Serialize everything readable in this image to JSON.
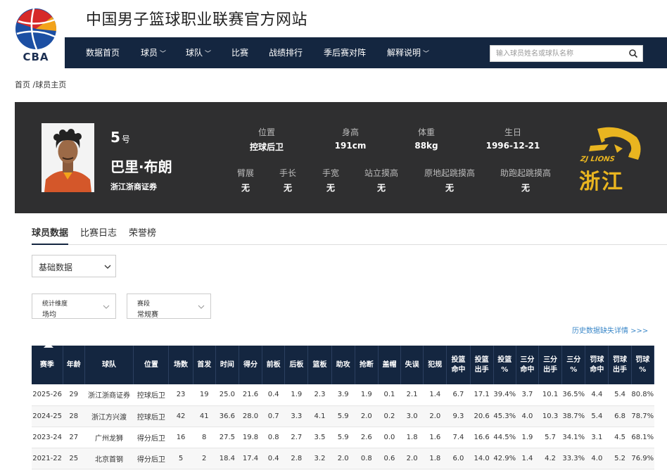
{
  "site_title": "中国男子篮球职业联赛官方网站",
  "logo_text": "CBA",
  "nav": [
    {
      "label": "数据首页",
      "dropdown": false
    },
    {
      "label": "球员",
      "dropdown": true
    },
    {
      "label": "球队",
      "dropdown": true
    },
    {
      "label": "比赛",
      "dropdown": false
    },
    {
      "label": "战绩排行",
      "dropdown": false
    },
    {
      "label": "季后赛对阵",
      "dropdown": false
    },
    {
      "label": "解释说明",
      "dropdown": true
    }
  ],
  "search": {
    "placeholder": "输入球员姓名或球队名称"
  },
  "breadcrumb": "首页 /球员主页",
  "player": {
    "number": "5",
    "number_suffix": "号",
    "name": "巴里·布朗",
    "team": "浙江浙商证券",
    "attrs_row1": [
      {
        "label": "位置",
        "value": "控球后卫"
      },
      {
        "label": "身高",
        "value": "191cm"
      },
      {
        "label": "体重",
        "value": "88kg"
      },
      {
        "label": "生日",
        "value": "1996-12-21"
      }
    ],
    "attrs_row2": [
      {
        "label": "臂展",
        "value": "无"
      },
      {
        "label": "手长",
        "value": "无"
      },
      {
        "label": "手宽",
        "value": "无"
      },
      {
        "label": "站立摸高",
        "value": "无"
      },
      {
        "label": "原地起跳摸高",
        "value": "无"
      },
      {
        "label": "助跑起跳摸高",
        "value": "无"
      }
    ],
    "team_logo_text": "ZJ LIONS",
    "team_logo_cn": "浙江"
  },
  "tabs": [
    "球员数据",
    "比赛日志",
    "荣誉榜"
  ],
  "filters": {
    "data_type": "基础数据",
    "dimension_label": "统计维度",
    "dimension_value": "场均",
    "stage_label": "赛段",
    "stage_value": "常规赛"
  },
  "history_link": "历史数据缺失详情 >>>",
  "table": {
    "headers": [
      "赛季",
      "年龄",
      "球队",
      "位置",
      "场数",
      "首发",
      "时间",
      "得分",
      "前板",
      "后板",
      "篮板",
      "助攻",
      "抢断",
      "盖帽",
      "失误",
      "犯规",
      "投篮\n命中",
      "投篮\n出手",
      "投篮\n%",
      "三分\n命中",
      "三分\n出手",
      "三分\n%",
      "罚球\n命中",
      "罚球\n出手",
      "罚球\n%"
    ],
    "rows": [
      [
        "2025-26",
        "29",
        "浙江浙商证券",
        "控球后卫",
        "23",
        "19",
        "25.0",
        "21.6",
        "0.4",
        "1.9",
        "2.3",
        "3.9",
        "1.9",
        "0.1",
        "2.1",
        "1.4",
        "6.7",
        "17.1",
        "39.4%",
        "3.7",
        "10.1",
        "36.5%",
        "4.4",
        "5.4",
        "80.8%"
      ],
      [
        "2024-25",
        "28",
        "浙江方兴渡",
        "控球后卫",
        "42",
        "41",
        "36.6",
        "28.0",
        "0.7",
        "3.3",
        "4.1",
        "5.9",
        "2.0",
        "0.2",
        "3.0",
        "2.0",
        "9.3",
        "20.6",
        "45.3%",
        "4.0",
        "10.3",
        "38.7%",
        "5.4",
        "6.8",
        "78.7%"
      ],
      [
        "2023-24",
        "27",
        "广州龙狮",
        "得分后卫",
        "16",
        "8",
        "27.5",
        "19.8",
        "0.8",
        "2.7",
        "3.5",
        "5.9",
        "2.6",
        "0.0",
        "1.8",
        "1.6",
        "7.4",
        "16.6",
        "44.5%",
        "1.9",
        "5.7",
        "34.1%",
        "3.1",
        "4.5",
        "68.1%"
      ],
      [
        "2021-22",
        "25",
        "北京首钢",
        "得分后卫",
        "5",
        "2",
        "18.4",
        "17.4",
        "0.4",
        "2.8",
        "3.2",
        "2.0",
        "0.8",
        "0.6",
        "2.0",
        "1.8",
        "6.0",
        "14.0",
        "42.9%",
        "1.4",
        "4.2",
        "33.3%",
        "4.0",
        "5.2",
        "76.9%"
      ]
    ]
  },
  "colors": {
    "nav_bg": "#142640",
    "banner_bg": "#2f2f30",
    "link": "#3a87c8",
    "team_gold": "#e9b520"
  }
}
